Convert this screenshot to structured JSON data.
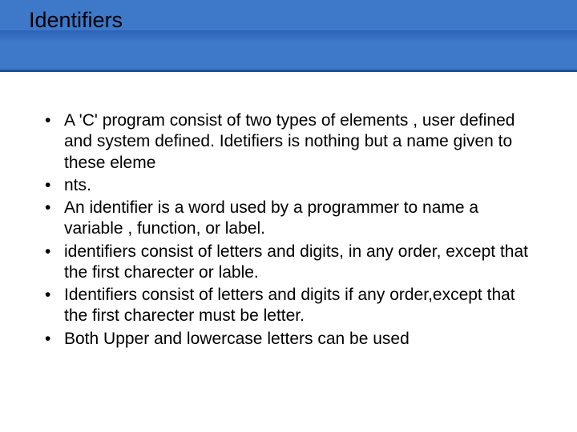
{
  "title": "Identifiers",
  "bullets": [
    "A 'C' program consist of two types of elements , user defined and system defined. Idetifiers is nothing but a name given to these eleme",
    "nts.",
    "An identifier is a word used by a programmer to name a variable , function, or label.",
    "identifiers consist of letters and digits, in any order, except that the first charecter or lable.",
    "Identifiers consist of letters and digits if any order,except that the first charecter must be letter.",
    "Both Upper and lowercase letters can be used"
  ]
}
